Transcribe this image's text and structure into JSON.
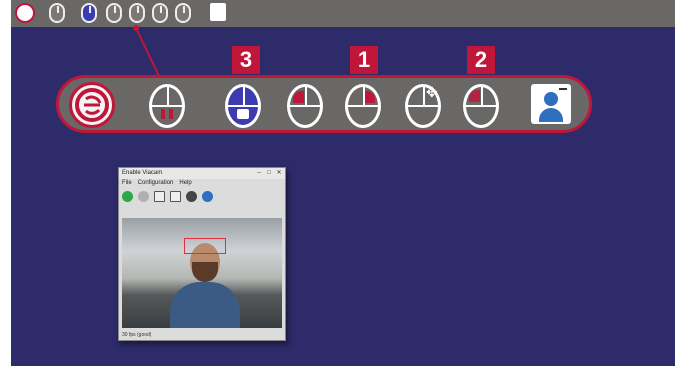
{
  "window": {
    "title": "Enable Viacam",
    "menu": [
      "File",
      "Configuration",
      "Help"
    ],
    "status": "30 fps (good)"
  },
  "badges": [
    "3",
    "1",
    "2"
  ],
  "icons": {
    "eviacam_logo": "eviacam-logo-icon",
    "mouse": "mouse-icon",
    "lock": "lock-icon",
    "move": "move-arrows-icon",
    "user": "user-icon"
  },
  "colors": {
    "desktop": "#2e2b6b",
    "accent": "#c0163a",
    "bar": "#6a6866"
  }
}
